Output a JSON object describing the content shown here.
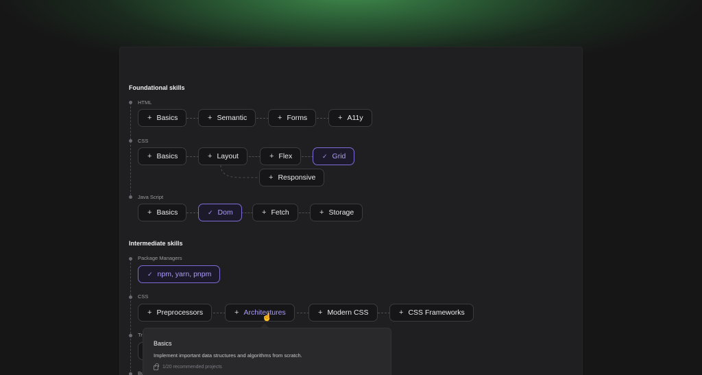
{
  "sections": {
    "foundational": "Foundational skills",
    "intermediate": "Intermediate skills"
  },
  "groups": {
    "html": "HTML",
    "css": "CSS",
    "js": "Java Script",
    "pkg": "Package Managers",
    "css2": "CSS",
    "tr": "Tr",
    "bu": "Bu"
  },
  "chips": {
    "html_basics": "Basics",
    "html_semantic": "Semantic",
    "html_forms": "Forms",
    "html_a11y": "A11y",
    "css_basics": "Basics",
    "css_layout": "Layout",
    "css_flex": "Flex",
    "css_grid": "Grid",
    "css_responsive": "Responsive",
    "js_basics": "Basics",
    "js_dom": "Dom",
    "js_fetch": "Fetch",
    "js_storage": "Storage",
    "pkg_npm": "npm, yarn, pnpm",
    "css2_pre": "Preprocessors",
    "css2_arch": "Architectures",
    "css2_modern": "Modern CSS",
    "css2_frameworks": "CSS Frameworks"
  },
  "icons": {
    "plus": "+",
    "check": "✓",
    "cursor": "☝"
  },
  "tooltip": {
    "title": "Basics",
    "description": "Implement important data structures and algorithms from scratch.",
    "meta": "1/20 recommended projects"
  },
  "colors": {
    "accent": "#a99cf7",
    "accent_border": "#7c6cd6",
    "glow": "#3f8a4c"
  }
}
